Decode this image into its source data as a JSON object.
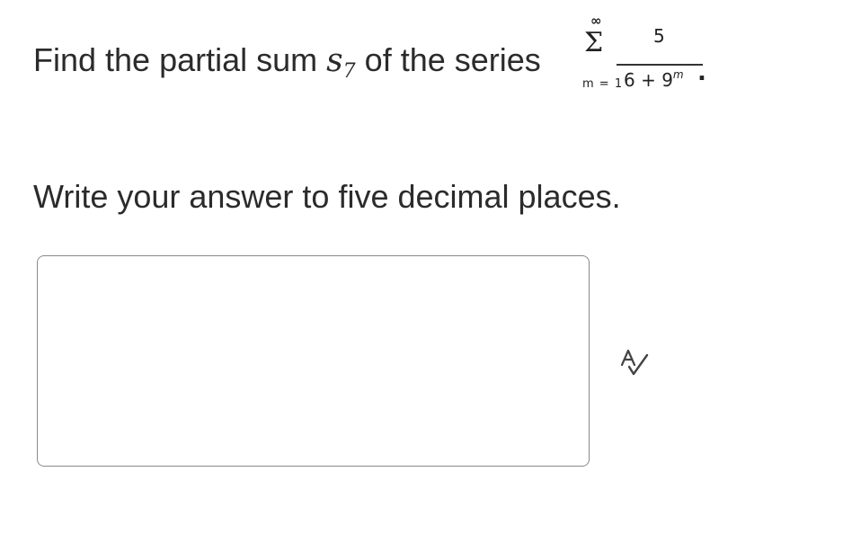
{
  "question": {
    "prefix": "Find the partial sum",
    "symbol_letter": "s",
    "symbol_subscript": "7",
    "suffix": "of the series",
    "series": {
      "upper_limit": "∞",
      "sigma": "Σ",
      "lower_limit": "m = 1",
      "numerator": "5",
      "denominator_base": "6 + 9",
      "denominator_exponent": "m",
      "trailing": "."
    }
  },
  "instruction": "Write your answer to five decimal places.",
  "answer_input": {
    "value": "",
    "placeholder": ""
  },
  "icons": {
    "spellcheck": "spellcheck-icon"
  }
}
